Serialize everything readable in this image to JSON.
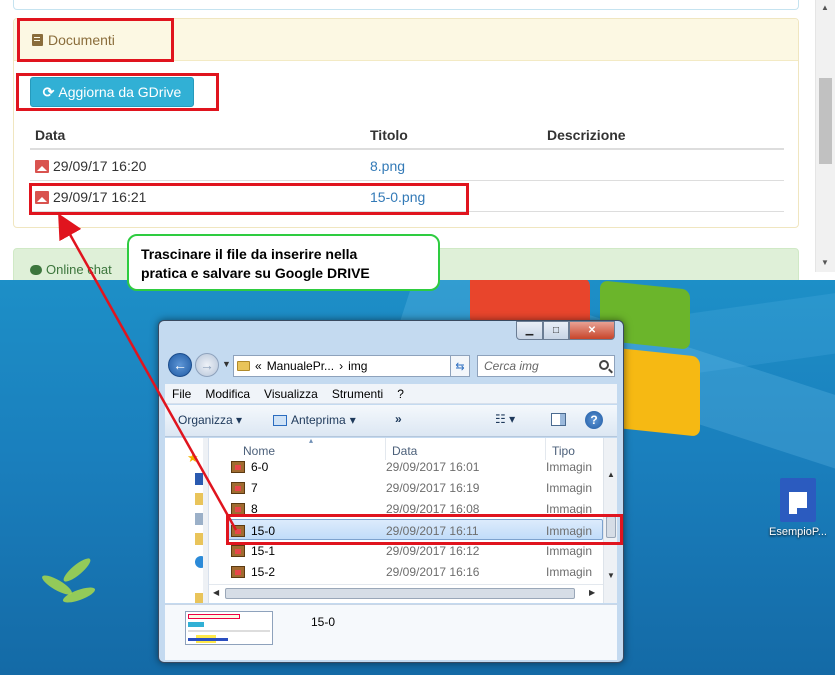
{
  "webpage": {
    "documents_panel": {
      "title": "Documenti",
      "gdrive_button": "Aggiorna da GDrive",
      "table": {
        "headers": [
          "Data",
          "Titolo",
          "Descrizione"
        ],
        "rows": [
          {
            "date": "29/09/17 16:20",
            "title": "8.png",
            "description": ""
          },
          {
            "date": "29/09/17 16:21",
            "title": "15-0.png",
            "description": ""
          }
        ]
      }
    },
    "chat_panel": {
      "title": "Online chat"
    }
  },
  "callout": {
    "line1": "Trascinare il file da inserire nella",
    "line2": "pratica e salvare su Google DRIVE"
  },
  "desktop": {
    "icon_label": "EsempioP..."
  },
  "explorer": {
    "address": {
      "prefix": "«",
      "segments": [
        "ManualePr...",
        "img"
      ],
      "separator": "›"
    },
    "search_placeholder": "Cerca img",
    "menu": [
      "File",
      "Modifica",
      "Visualizza",
      "Strumenti",
      "?"
    ],
    "toolbar": {
      "organize": "Organizza",
      "preview": "Anteprima",
      "more": "»"
    },
    "columns": [
      "Nome",
      "Data",
      "Tipo"
    ],
    "files": [
      {
        "name": "6-0",
        "date": "29/09/2017 16:01",
        "type": "Immagin"
      },
      {
        "name": "7",
        "date": "29/09/2017 16:19",
        "type": "Immagin"
      },
      {
        "name": "8",
        "date": "29/09/2017 16:08",
        "type": "Immagin"
      },
      {
        "name": "15-0",
        "date": "29/09/2017 16:11",
        "type": "Immagin",
        "selected": true
      },
      {
        "name": "15-1",
        "date": "29/09/2017 16:12",
        "type": "Immagin"
      },
      {
        "name": "15-2",
        "date": "29/09/2017 16:16",
        "type": "Immagin"
      }
    ],
    "details_name": "15-0"
  },
  "colors": {
    "annotation_red": "#e0141e",
    "callout_border": "#2ecc40",
    "button_info": "#31b0d5",
    "panel_warning_bg": "#fcf8e3",
    "link": "#337ab7"
  }
}
